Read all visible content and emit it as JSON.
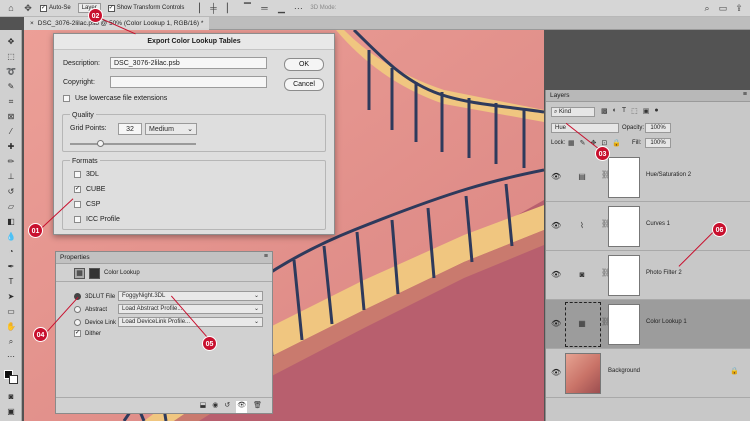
{
  "option_bar": {
    "auto_select_label": "Auto-Se",
    "layer_select": "Layer",
    "show_transform_label": "Show Transform Controls",
    "mode_3d": "3D Mode:"
  },
  "document_tab": {
    "title": "DSC_3076-2lilac.psb @ 50% (Color Lookup 1, RGB/16) *"
  },
  "export_dialog": {
    "title": "Export Color Lookup Tables",
    "description_label": "Description:",
    "description_value": "DSC_3076-2lilac.psb",
    "copyright_label": "Copyright:",
    "copyright_value": "",
    "lowercase_label": "Use lowercase file extensions",
    "quality_heading": "Quality",
    "grid_points_label": "Grid Points:",
    "grid_points_value": "32",
    "quality_select": "Medium",
    "formats_heading": "Formats",
    "formats": [
      {
        "label": "3DL",
        "checked": false
      },
      {
        "label": "CUBE",
        "checked": true
      },
      {
        "label": "CSP",
        "checked": false
      },
      {
        "label": "ICC Profile",
        "checked": false
      }
    ],
    "ok_label": "OK",
    "cancel_label": "Cancel"
  },
  "properties_panel": {
    "title": "Properties",
    "subtitle": "Color Lookup",
    "rows": [
      {
        "label": "3DLUT File",
        "value": "FoggyNight.3DL",
        "selected": true
      },
      {
        "label": "Abstract",
        "value": "Load Abstract Profile...",
        "selected": false
      },
      {
        "label": "Device Link",
        "value": "Load DeviceLink Profile...",
        "selected": false
      }
    ],
    "dither_label": "Dither"
  },
  "layers_panel": {
    "title": "Layers",
    "filter_kind": "Kind",
    "blend_mode": "Hue",
    "opacity_label": "Opacity:",
    "opacity_value": "100%",
    "lock_label": "Lock:",
    "fill_label": "Fill:",
    "fill_value": "100%",
    "layers": [
      {
        "name": "Hue/Saturation 2",
        "icon": "hue-saturation-icon"
      },
      {
        "name": "Curves 1",
        "icon": "curves-icon"
      },
      {
        "name": "Photo Filter 2",
        "icon": "photo-filter-icon"
      },
      {
        "name": "Color Lookup 1",
        "icon": "color-lookup-icon",
        "selected": true
      },
      {
        "name": "Background",
        "icon": "image-thumbnail",
        "locked": true
      }
    ]
  },
  "callouts": [
    "01",
    "02",
    "03",
    "04",
    "05",
    "06"
  ],
  "colors": {
    "callout": "#c8102e",
    "canvas_pink": "#df8c88",
    "stair_blue": "#2e3a5c",
    "step_yellow": "#f0c680"
  }
}
